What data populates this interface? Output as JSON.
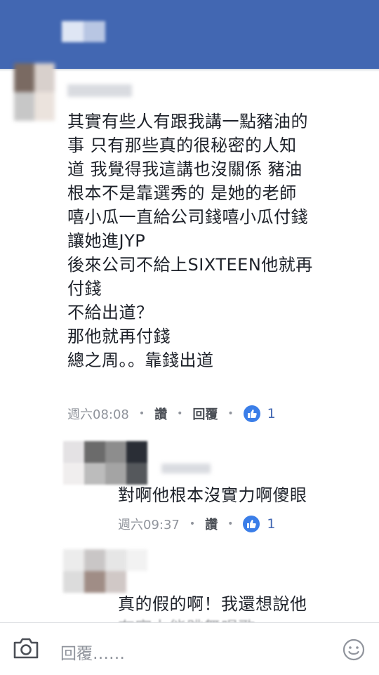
{
  "comments": [
    {
      "text": "其實有些人有跟我講一點豬油的\n事 只有那些真的很秘密的人知\n道 我覺得我這講也沒關係 豬油\n根本不是靠選秀的 是她的老師\n嘻小瓜一直給公司錢嘻小瓜付錢\n讓她進JYP\n後來公司不給上SIXTEEN他就再\n付錢\n不給出道？\n那他就再付錢\n總之周。。靠錢出道",
      "time": "週六08:08",
      "like_label": "讚",
      "reply_label": "回覆",
      "like_count": "1"
    },
    {
      "text": "對啊他根本沒實力啊傻眼",
      "time": "週六09:37",
      "like_label": "讚",
      "like_count": "1"
    },
    {
      "text": "真的假的啊！我還想說他",
      "cut_off_line": "有實力能跳舞唱歌"
    }
  ],
  "separator": "•",
  "composer": {
    "placeholder": "回覆……"
  },
  "colors": {
    "header": "#4267b2",
    "like_badge": "#3b7ee8",
    "meta_text": "#90949c"
  },
  "icons": [
    "camera-icon",
    "thumbs-up-icon",
    "smiley-icon"
  ]
}
